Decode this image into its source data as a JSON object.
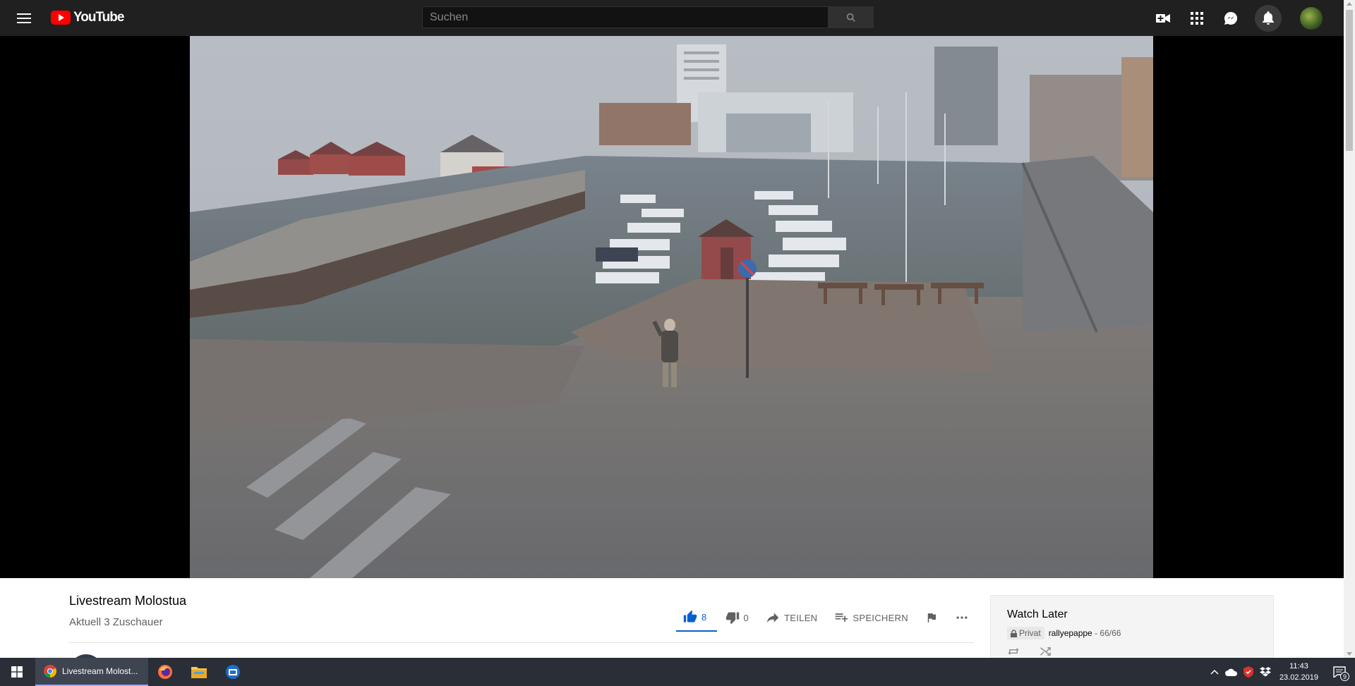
{
  "header": {
    "logo_text": "YouTube",
    "search_placeholder": "Suchen"
  },
  "video": {
    "title": "Livestream Molostua",
    "viewers": "Aktuell 3 Zuschauer",
    "actions": {
      "likes": "8",
      "dislikes": "0",
      "share_label": "TEILEN",
      "save_label": "SPEICHERN"
    }
  },
  "playlist": {
    "title": "Watch Later",
    "privacy": "Privat",
    "channel": "rallyepappe",
    "separator": " - ",
    "position": "66/66"
  },
  "taskbar": {
    "active_window": "Livestream Molost...",
    "time": "11:43",
    "date": "23.02.2019",
    "notification_count": "9"
  },
  "colors": {
    "accent_blue": "#065fd4",
    "youtube_red": "#ff0000",
    "topbar": "#202020",
    "taskbar": "#2a2e37"
  }
}
